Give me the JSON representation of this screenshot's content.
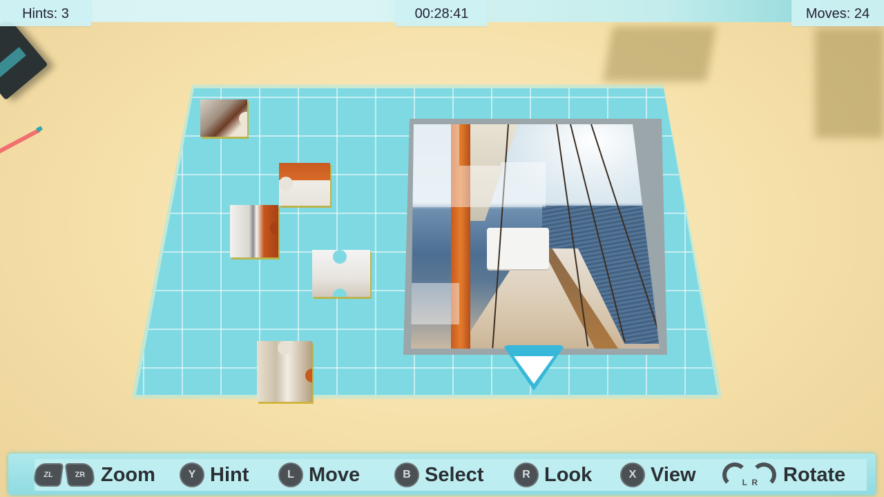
{
  "hud": {
    "hints_label": "Hints: 3",
    "timer": "00:28:41",
    "moves_label": "Moves: 24"
  },
  "controls": [
    {
      "buttons": [
        "ZL",
        "ZR"
      ],
      "label": "Zoom"
    },
    {
      "buttons": [
        "Y"
      ],
      "label": "Hint"
    },
    {
      "buttons": [
        "L"
      ],
      "label": "Move"
    },
    {
      "buttons": [
        "B"
      ],
      "label": "Select"
    },
    {
      "buttons": [
        "R"
      ],
      "label": "Look"
    },
    {
      "buttons": [
        "X"
      ],
      "label": "View"
    },
    {
      "buttons": [
        "L",
        "R"
      ],
      "label": "Rotate"
    }
  ],
  "colors": {
    "board": "#7fd9e2",
    "table": "#f5e0a8",
    "cursor": "#38b8d8",
    "control_bar": "#8fdbe1"
  },
  "icons": {
    "cursor": "selection-triangle-icon",
    "shoulder": "shoulder-button-icon",
    "face": "face-button-icon",
    "stick": "analog-stick-icon"
  }
}
